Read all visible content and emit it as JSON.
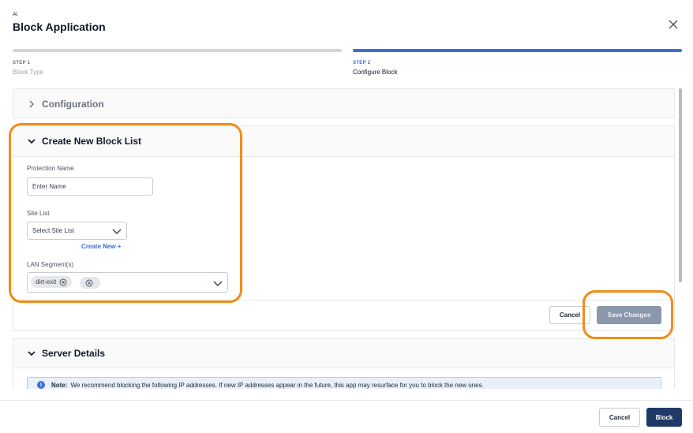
{
  "header": {
    "eyebrow": "AI",
    "title": "Block Application",
    "close_icon": "close-icon"
  },
  "steps": [
    {
      "number": "STEP 1",
      "name": "Block Type",
      "state": "completed"
    },
    {
      "number": "STEP 2",
      "name": "Configure Block",
      "state": "active"
    }
  ],
  "sections": {
    "configuration": {
      "title": "Configuration",
      "expanded": false
    },
    "create_block_list": {
      "title": "Create New Block List",
      "expanded": true,
      "protection_name": {
        "label": "Protection Name",
        "placeholder": "Enter Name",
        "value": ""
      },
      "site_list": {
        "label": "Site List",
        "placeholder": "Select Site List",
        "create_new_label": "Create New +"
      },
      "lan_segments": {
        "label": "LAN Segment(s)",
        "chips": [
          "dirt-exit",
          ""
        ]
      },
      "cancel_label": "Cancel",
      "save_label": "Save Changes",
      "save_enabled": false
    },
    "server_details": {
      "title": "Server Details",
      "expanded": true,
      "note_label": "Note:",
      "note_text": "We recommend blocking the following IP addresses. If new IP addresses appear in the future, this app may resurface for you to block the new ones."
    }
  },
  "footer": {
    "cancel_label": "Cancel",
    "block_label": "Block"
  },
  "colors": {
    "accent": "#3b6fd4",
    "primary_button": "#1f3a66",
    "disabled_button": "#8b97ab",
    "highlight_ring": "#f28c18"
  }
}
